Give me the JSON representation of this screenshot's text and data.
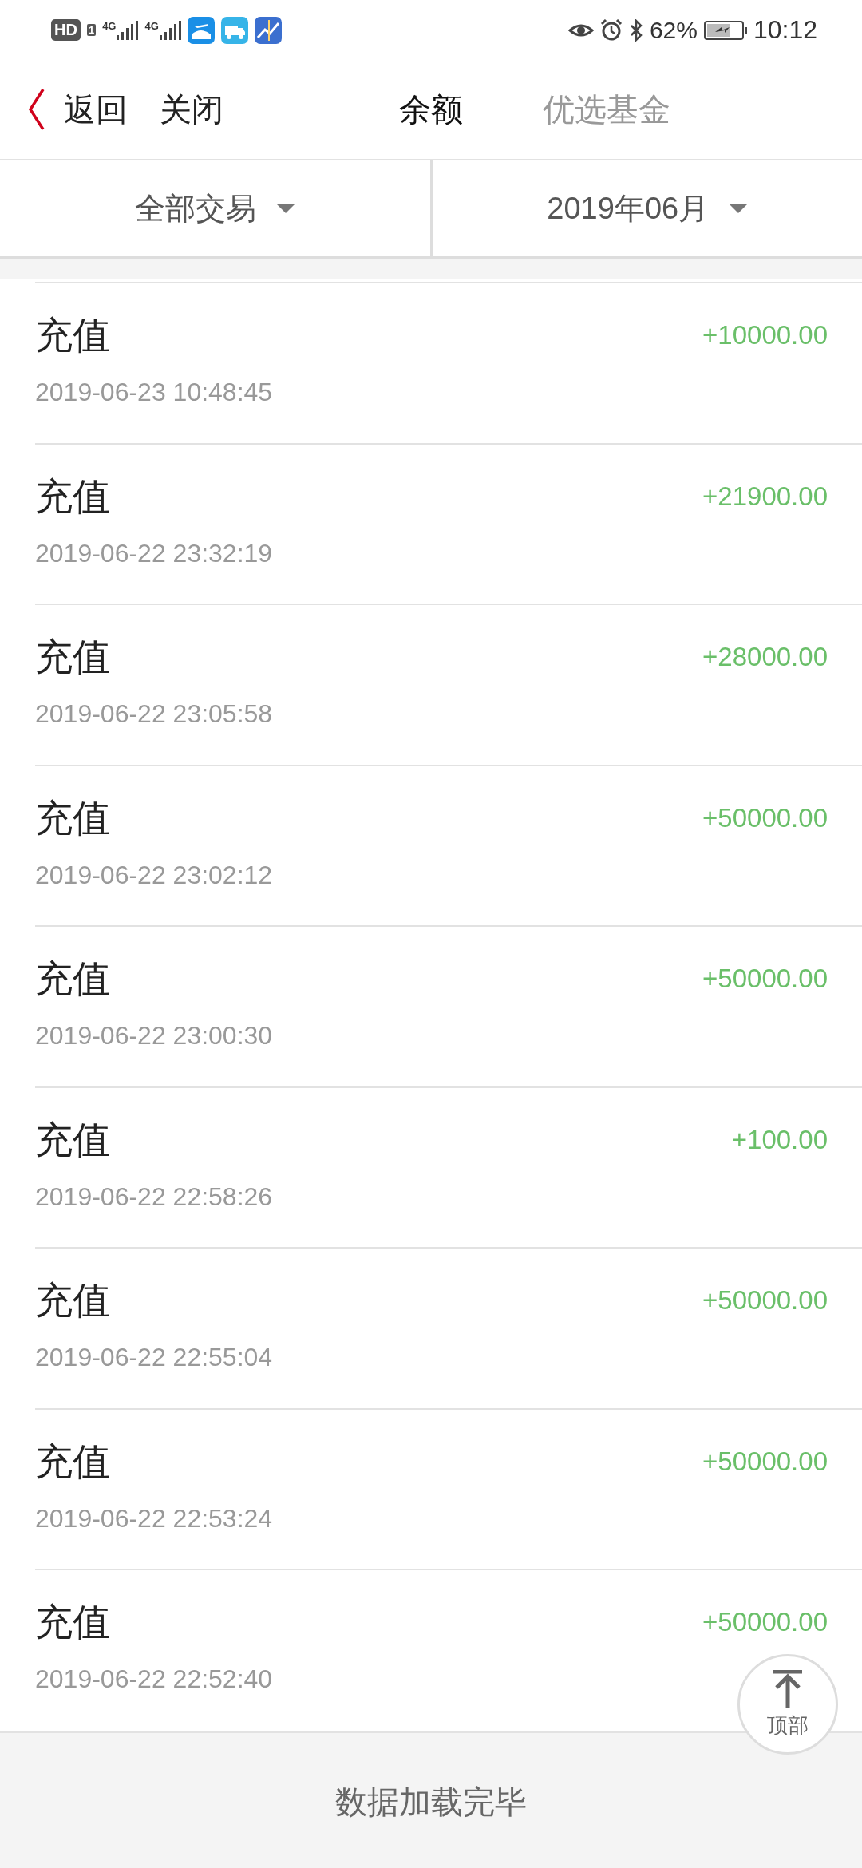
{
  "status_bar": {
    "hd": "HD",
    "sim": "1",
    "networks": [
      "4G",
      "4G"
    ],
    "battery_percent": "62%",
    "time": "10:12"
  },
  "nav": {
    "back": "返回",
    "close": "关闭",
    "tabs": [
      {
        "label": "余额",
        "selected": true
      },
      {
        "label": "优选基金",
        "selected": false
      }
    ]
  },
  "filters": [
    {
      "label": "全部交易"
    },
    {
      "label": "2019年06月"
    }
  ],
  "transactions": [
    {
      "title": "充值",
      "time": "2019-06-23 10:48:45",
      "amount": "+10000.00"
    },
    {
      "title": "充值",
      "time": "2019-06-22 23:32:19",
      "amount": "+21900.00"
    },
    {
      "title": "充值",
      "time": "2019-06-22 23:05:58",
      "amount": "+28000.00"
    },
    {
      "title": "充值",
      "time": "2019-06-22 23:02:12",
      "amount": "+50000.00"
    },
    {
      "title": "充值",
      "time": "2019-06-22 23:00:30",
      "amount": "+50000.00"
    },
    {
      "title": "充值",
      "time": "2019-06-22 22:58:26",
      "amount": "+100.00"
    },
    {
      "title": "充值",
      "time": "2019-06-22 22:55:04",
      "amount": "+50000.00"
    },
    {
      "title": "充值",
      "time": "2019-06-22 22:53:24",
      "amount": "+50000.00"
    },
    {
      "title": "充值",
      "time": "2019-06-22 22:52:40",
      "amount": "+50000.00"
    }
  ],
  "back_to_top": {
    "label": "顶部"
  },
  "footer": {
    "message": "数据加载完毕"
  }
}
